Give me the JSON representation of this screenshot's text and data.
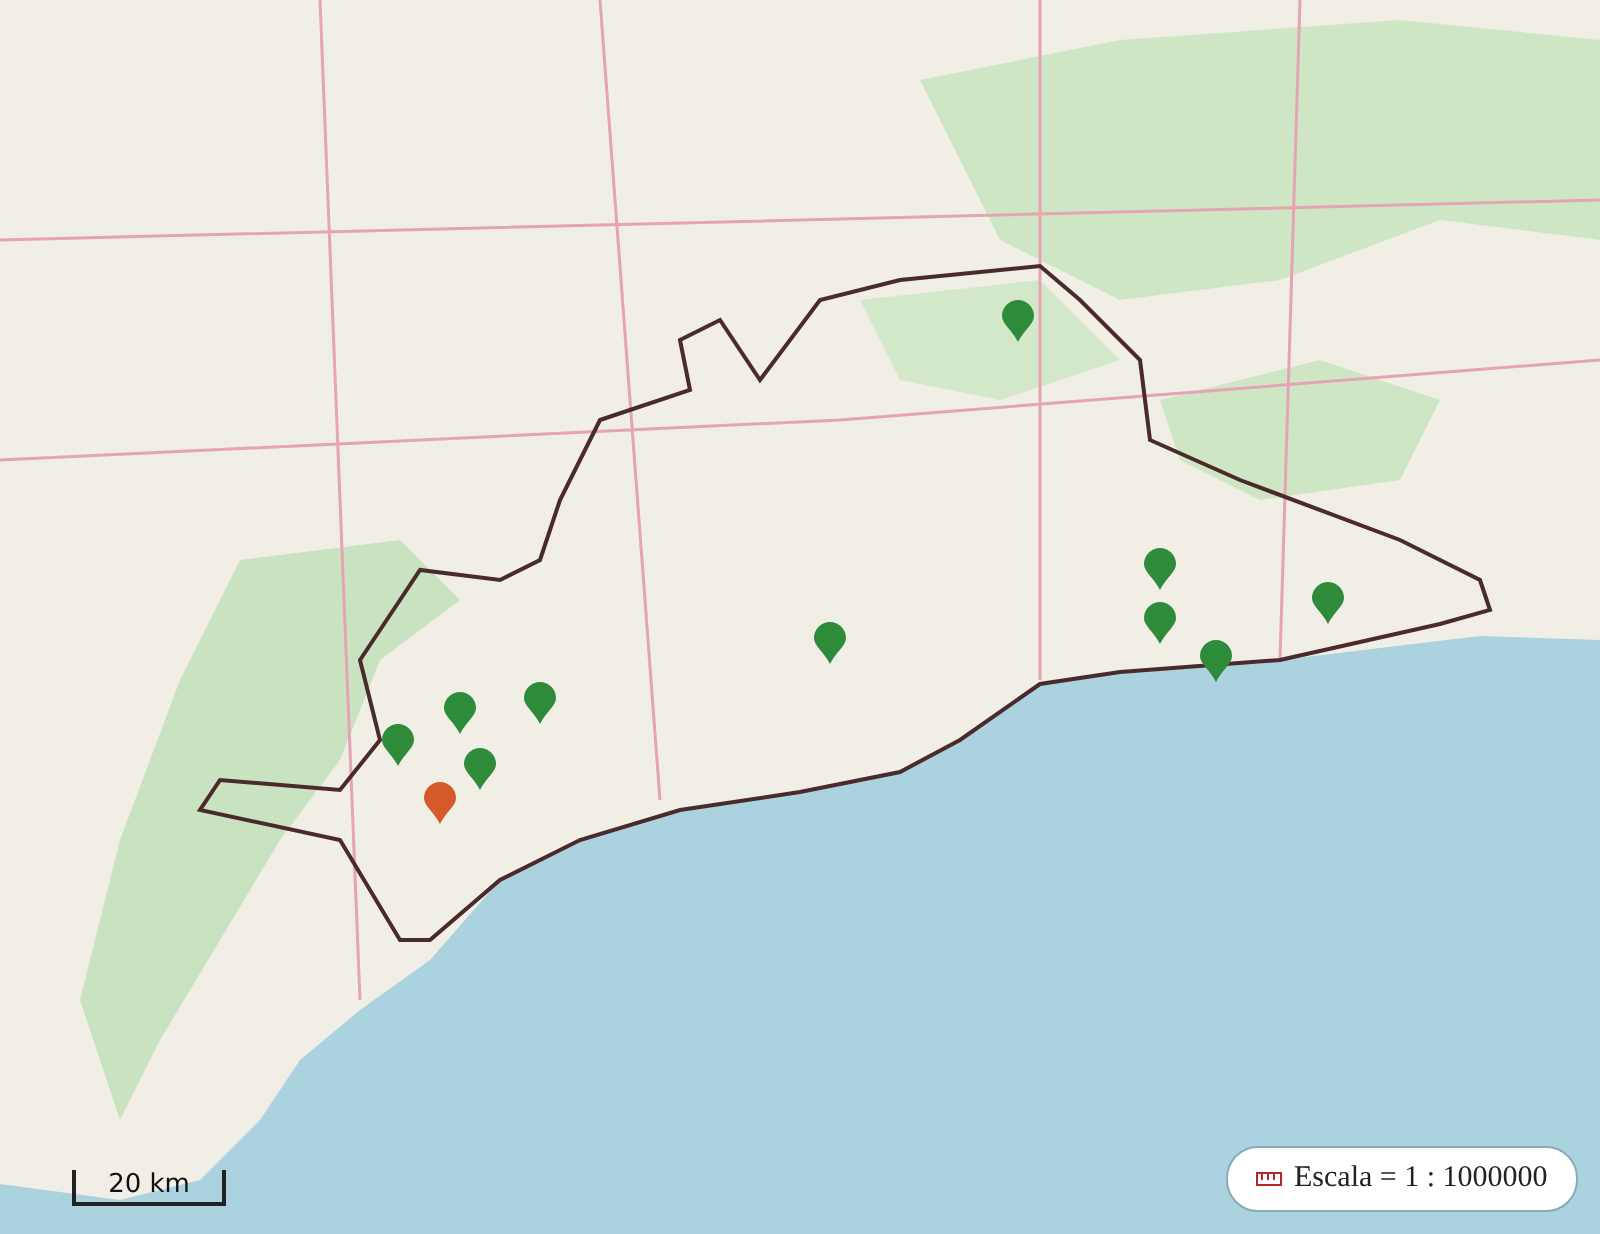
{
  "map": {
    "markers": [
      {
        "color": "#2e8b3a"
      },
      {
        "color": "#2e8b3a"
      },
      {
        "color": "#2e8b3a"
      },
      {
        "color": "#2e8b3a"
      },
      {
        "color": "#2e8b3a"
      },
      {
        "color": "#2e8b3a"
      },
      {
        "color": "#2e8b3a"
      },
      {
        "color": "#2e8b3a"
      },
      {
        "color": "#2e8b3a"
      },
      {
        "color": "#2e8b3a"
      },
      {
        "color": "#d45a2c"
      }
    ]
  },
  "scale_bar": {
    "label": "20 km"
  },
  "legend": {
    "text": "Escala = 1 : 1000000"
  }
}
